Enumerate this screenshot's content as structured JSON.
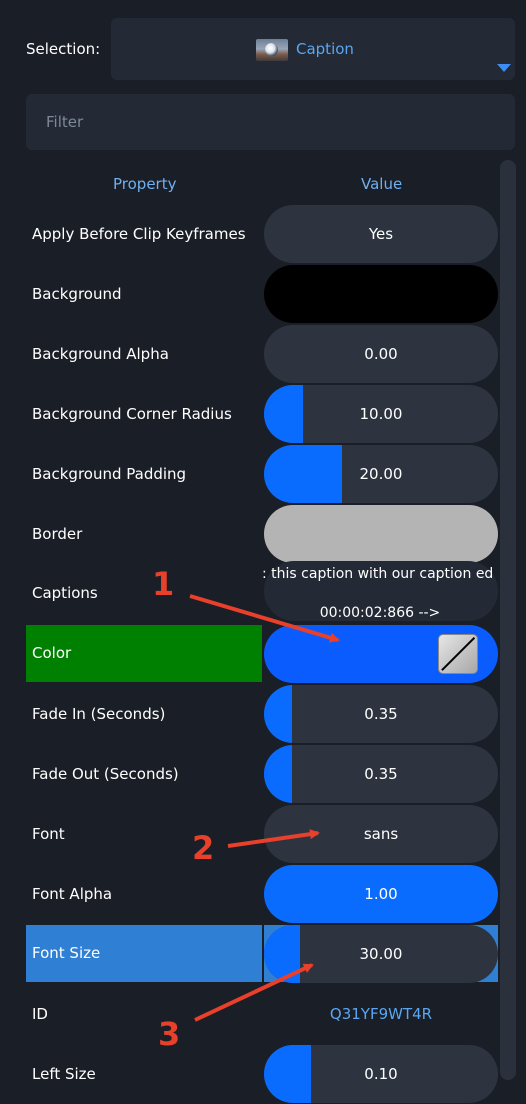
{
  "selection": {
    "label": "Selection:",
    "value": "Caption"
  },
  "filter": {
    "placeholder": "Filter",
    "value": ""
  },
  "headers": {
    "property": "Property",
    "value": "Value"
  },
  "properties": [
    {
      "name": "Apply Before Clip Keyframes",
      "value": "Yes"
    },
    {
      "name": "Background",
      "value": ""
    },
    {
      "name": "Background Alpha",
      "value": "0.00"
    },
    {
      "name": "Background Corner Radius",
      "value": "10.00"
    },
    {
      "name": "Background Padding",
      "value": "20.00"
    },
    {
      "name": "Border",
      "value": ""
    },
    {
      "name": "Captions",
      "value_line1": ": this caption with our caption ed",
      "value_line2": "00:00:02:866 -->"
    },
    {
      "name": "Color",
      "value": ""
    },
    {
      "name": "Fade In (Seconds)",
      "value": "0.35"
    },
    {
      "name": "Fade Out (Seconds)",
      "value": "0.35"
    },
    {
      "name": "Font",
      "value": "sans"
    },
    {
      "name": "Font Alpha",
      "value": "1.00"
    },
    {
      "name": "Font Size",
      "value": "30.00"
    },
    {
      "name": "ID",
      "value": "Q31YF9WT4R"
    },
    {
      "name": "Left Size",
      "value": "0.10"
    }
  ],
  "annotations": [
    "1",
    "2",
    "3"
  ],
  "colors": {
    "accent_blue": "#0a6cff",
    "selected_green": "#008000",
    "selected_blue": "#2f7fd4",
    "annotation_red": "#e8402a",
    "link_blue": "#5aa6f2"
  }
}
